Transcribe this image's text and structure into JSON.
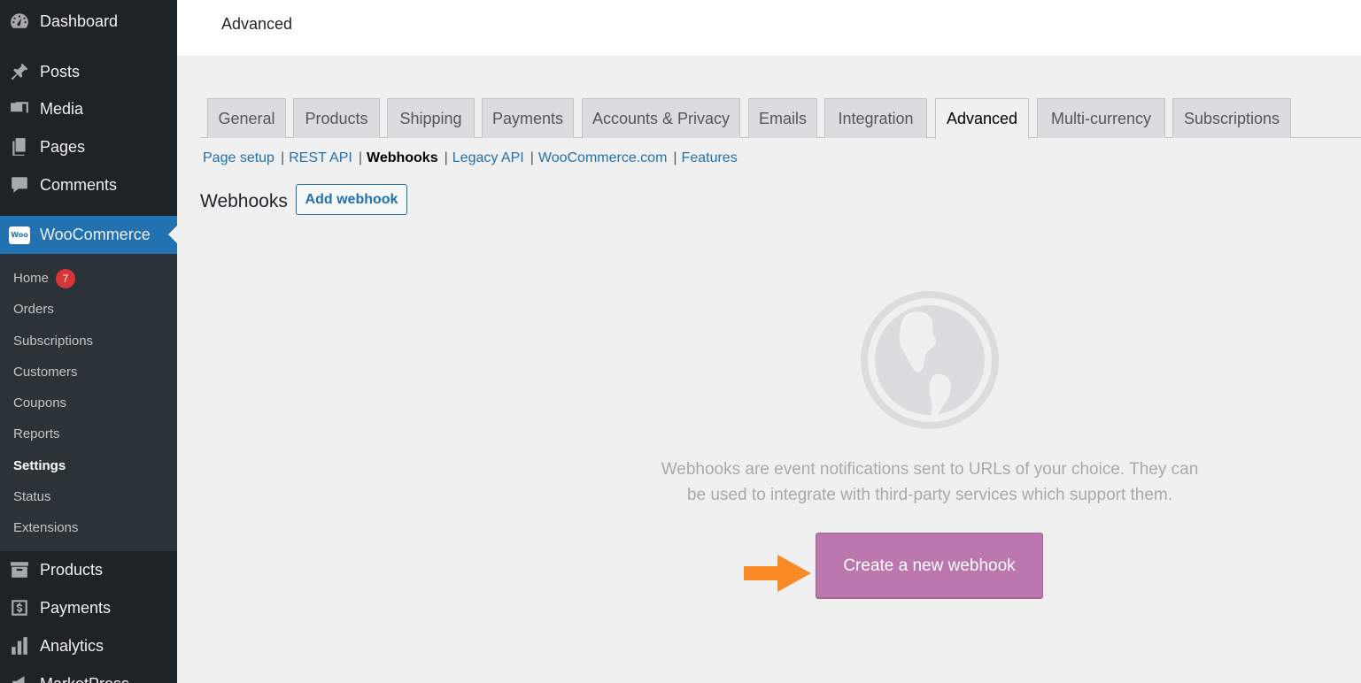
{
  "sidebar": {
    "top_items": [
      {
        "label": "Dashboard",
        "icon": "dashboard-icon"
      },
      {
        "label": "Posts",
        "icon": "pin-icon"
      },
      {
        "label": "Media",
        "icon": "media-icon"
      },
      {
        "label": "Pages",
        "icon": "pages-icon"
      },
      {
        "label": "Comments",
        "icon": "comment-icon"
      }
    ],
    "woocommerce": {
      "label": "WooCommerce",
      "icon_text": "Woo"
    },
    "submenu": [
      {
        "label": "Home",
        "badge": "7"
      },
      {
        "label": "Orders"
      },
      {
        "label": "Subscriptions"
      },
      {
        "label": "Customers"
      },
      {
        "label": "Coupons"
      },
      {
        "label": "Reports"
      },
      {
        "label": "Settings"
      },
      {
        "label": "Status"
      },
      {
        "label": "Extensions"
      }
    ],
    "bottom_items": [
      {
        "label": "Products",
        "icon": "archive-icon"
      },
      {
        "label": "Payments",
        "icon": "dollar-icon"
      },
      {
        "label": "Analytics",
        "icon": "chart-bar-icon"
      },
      {
        "label": "MarketPress",
        "icon": "megaphone-icon"
      }
    ]
  },
  "header": {
    "title": "Advanced"
  },
  "tabs": [
    "General",
    "Products",
    "Shipping",
    "Payments",
    "Accounts & Privacy",
    "Emails",
    "Integration",
    "Advanced",
    "Multi-currency",
    "Subscriptions"
  ],
  "active_tab": "Advanced",
  "sublinks": [
    "Page setup",
    "REST API",
    "Webhooks",
    "Legacy API",
    "WooCommerce.com",
    "Features"
  ],
  "active_sublink": "Webhooks",
  "section": {
    "title": "Webhooks",
    "add_button": "Add webhook"
  },
  "empty_state": {
    "message": "Webhooks are event notifications sent to URLs of your choice. They can be used to integrate with third-party services which support them.",
    "button": "Create a new webhook"
  },
  "colors": {
    "sidebar_bg": "#1d2327",
    "accent": "#2271b1",
    "woo_purple": "#bb77ae",
    "arrow": "#f98a26",
    "badge": "#d63638"
  }
}
